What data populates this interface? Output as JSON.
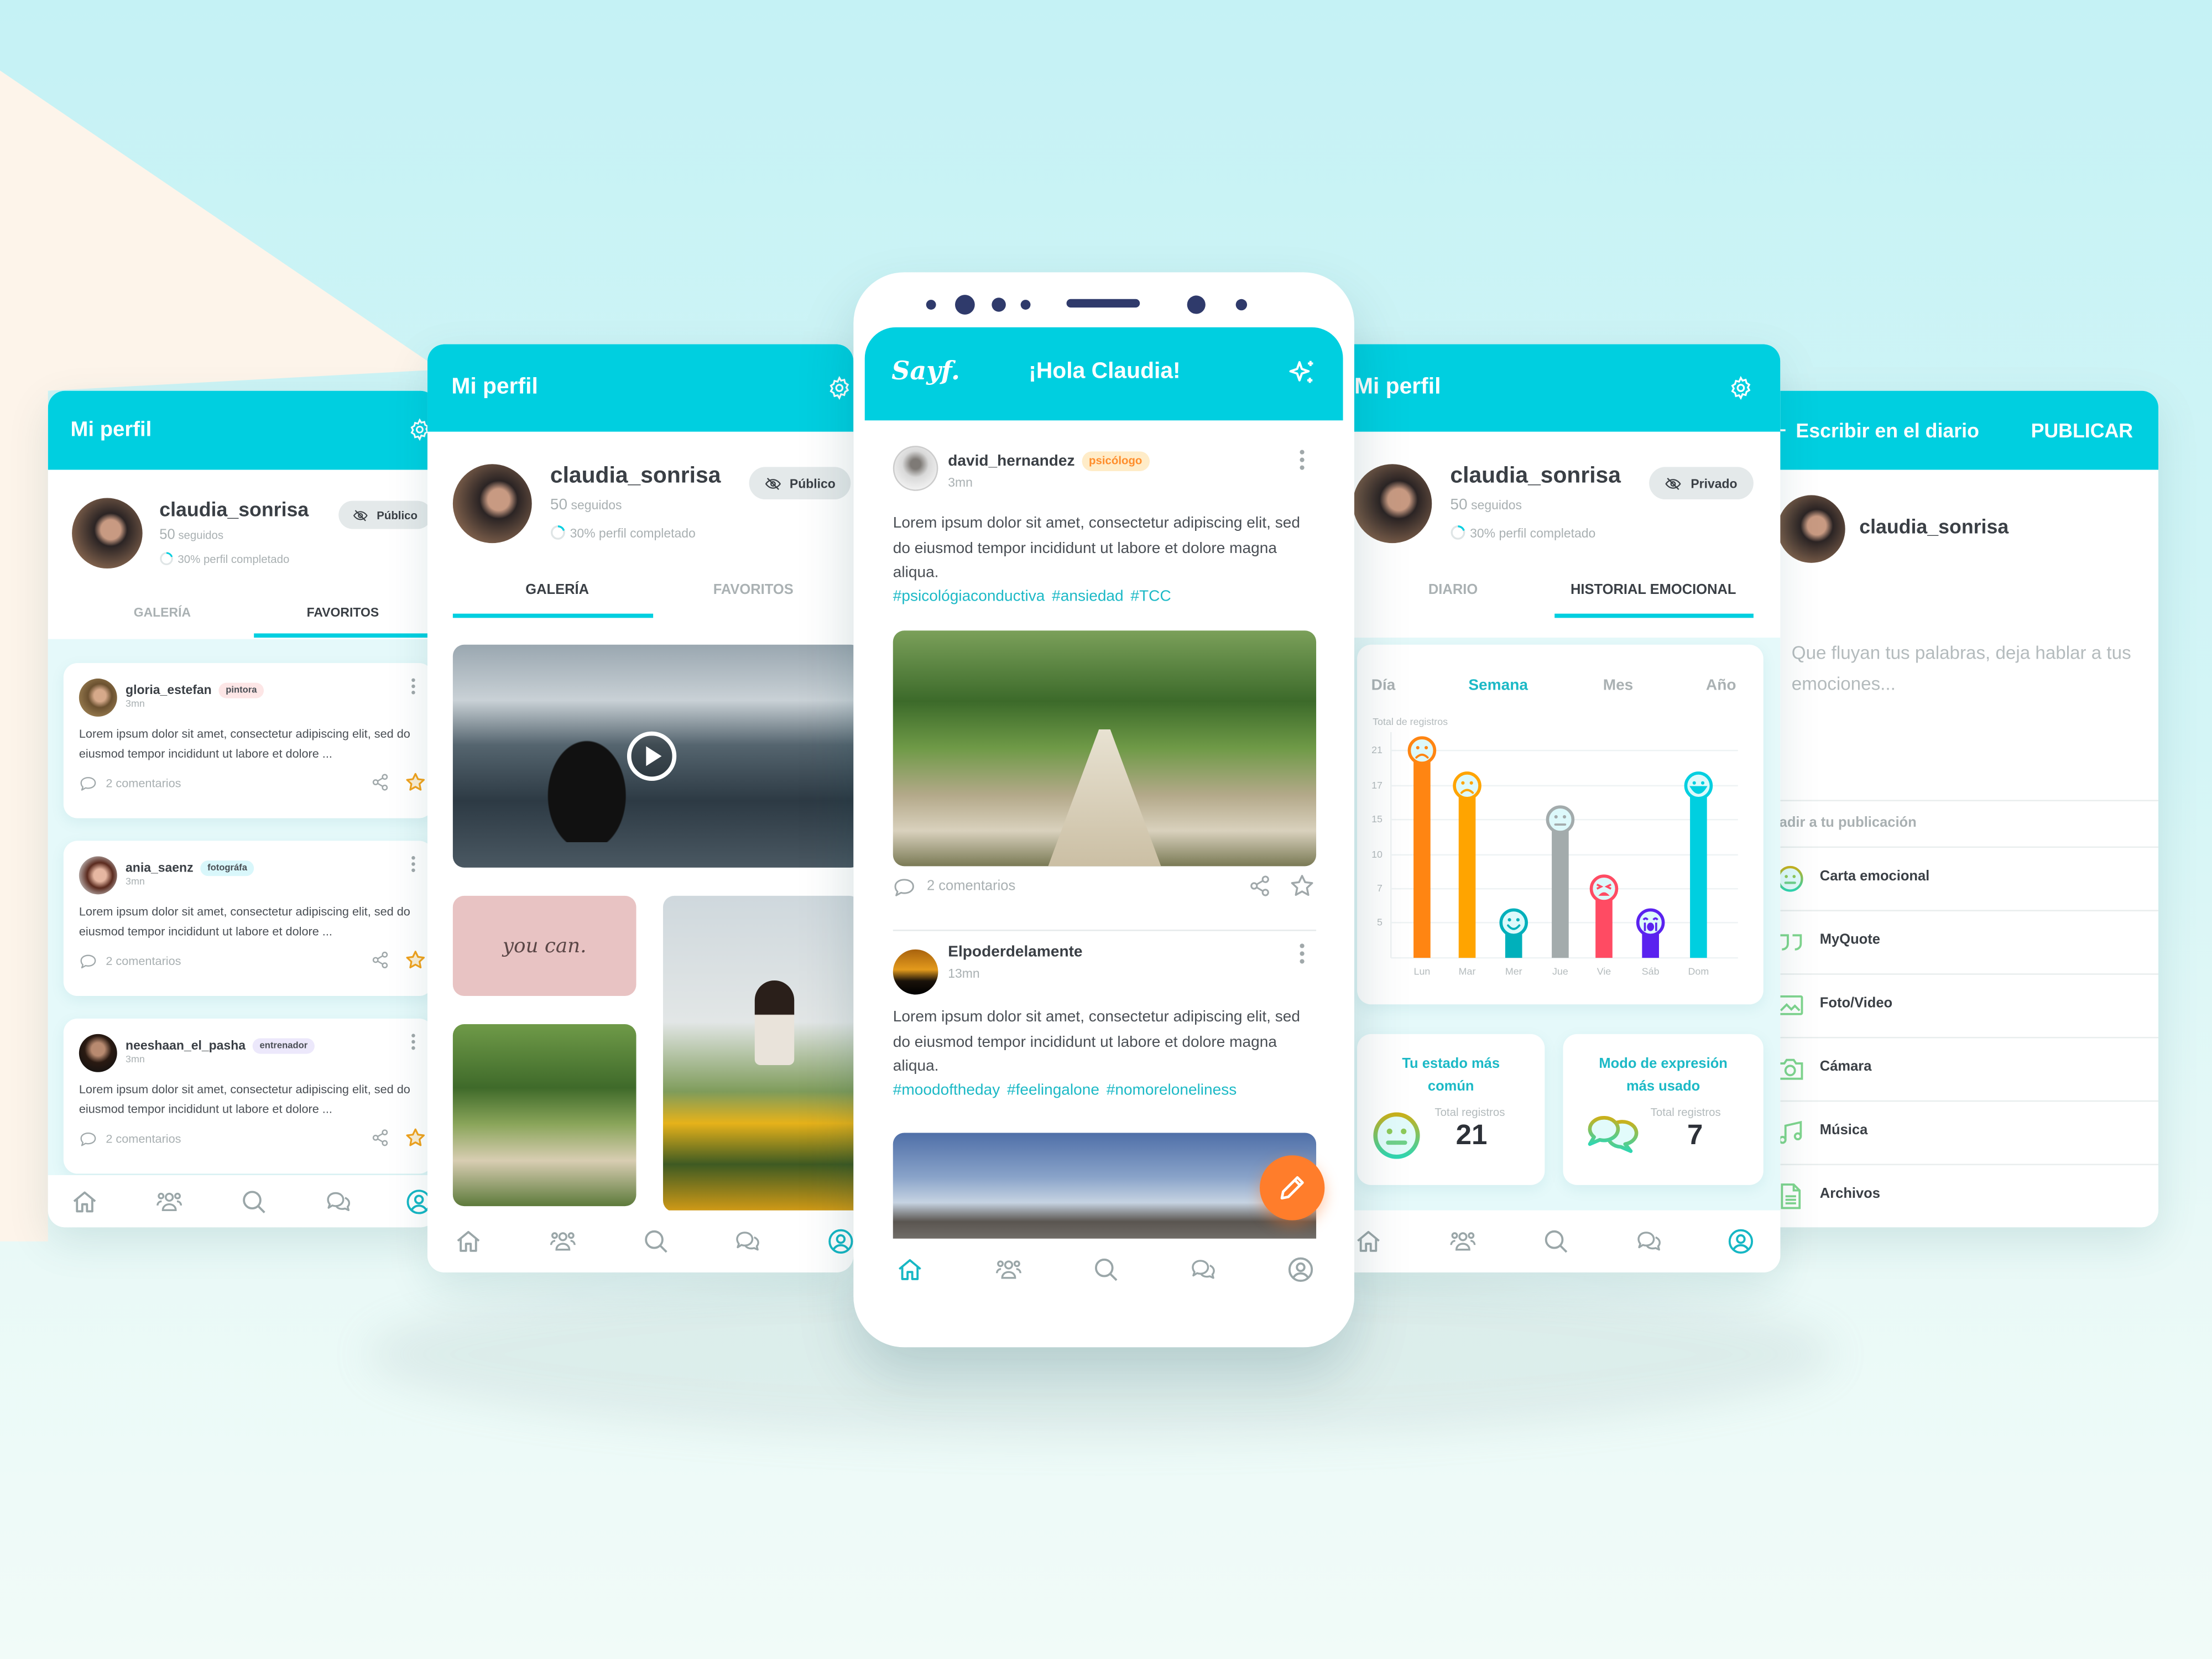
{
  "colors": {
    "brand": "#00cfe0",
    "accent_orange": "#ff7d2b",
    "text_dark": "#3a3f45",
    "text_muted": "#a9b0b2",
    "hashtag": "#1cb9c6",
    "star": "#f0a21d"
  },
  "panel_favorites": {
    "header_title": "Mi perfil",
    "profile": {
      "username": "claudia_sonrisa",
      "following_count": "50",
      "following_label": "seguidos",
      "completion_text": "30% perfil completado",
      "completion_pct": 30,
      "visibility": "Público"
    },
    "tabs": [
      {
        "label": "GALERÍA"
      },
      {
        "label": "FAVORITOS"
      }
    ],
    "active_tab": "FAVORITOS",
    "posts": [
      {
        "user": "gloria_estefan",
        "role": "pintora",
        "role_color": "#fde6e6",
        "time": "3mn",
        "text": "Lorem ipsum dolor sit amet, consectetur adipiscing elit, sed do eiusmod tempor incididunt ut labore et dolore ...",
        "comments": "2 comentarios"
      },
      {
        "user": "ania_saenz",
        "role": "fotográfa",
        "role_color": "#d9f7fb",
        "time": "3mn",
        "text": "Lorem ipsum dolor sit amet, consectetur adipiscing elit, sed do eiusmod tempor incididunt ut labore et dolore ...",
        "comments": "2 comentarios"
      },
      {
        "user": "neeshaan_el_pasha",
        "role": "entrenador",
        "role_color": "#ece8fb",
        "time": "3mn",
        "text": "Lorem ipsum dolor sit amet, consectetur adipiscing elit, sed do eiusmod tempor incididunt ut labore et dolore ...",
        "comments": "2 comentarios"
      }
    ],
    "active_nav": "profile"
  },
  "panel_gallery": {
    "header_title": "Mi perfil",
    "profile": {
      "username": "claudia_sonrisa",
      "following_count": "50",
      "following_label": "seguidos",
      "completion_text": "30% perfil completado",
      "completion_pct": 30,
      "visibility": "Público"
    },
    "tabs": [
      {
        "label": "GALERÍA"
      },
      {
        "label": "FAVORITOS"
      }
    ],
    "active_tab": "GALERÍA",
    "handwritten_card": "you can.",
    "active_nav": "profile"
  },
  "feed": {
    "logo": "Sayf.",
    "greeting": "¡Hola Claudia!",
    "posts": [
      {
        "user": "david_hernandez",
        "role": "psicólogo",
        "time": "3mn",
        "text": "Lorem ipsum dolor sit amet, consectetur adipiscing elit, sed do eiusmod tempor incididunt ut labore et dolore magna aliqua.",
        "hashtags": [
          "#psicológiaconductiva",
          "#ansiedad",
          "#TCC"
        ],
        "comments": "2 comentarios"
      },
      {
        "user": "Elpoderdelamente",
        "time": "13mn",
        "text": "Lorem ipsum dolor sit amet, consectetur adipiscing elit, sed do eiusmod tempor incididunt ut labore et dolore magna aliqua.",
        "hashtags": [
          "#moodoftheday",
          "#feelingalone",
          "#nomoreloneliness"
        ]
      }
    ],
    "active_nav": "home"
  },
  "panel_history": {
    "header_title": "Mi perfil",
    "profile": {
      "username": "claudia_sonrisa",
      "following_count": "50",
      "following_label": "seguidos",
      "completion_text": "30% perfil completado",
      "completion_pct": 30,
      "visibility": "Privado"
    },
    "tabs": [
      {
        "label": "DIARIO"
      },
      {
        "label": "HISTORIAL EMOCIONAL"
      }
    ],
    "active_tab": "HISTORIAL EMOCIONAL",
    "periods": [
      "Día",
      "Semana",
      "Mes",
      "Año"
    ],
    "active_period": "Semana",
    "stats": [
      {
        "title": "Tu estado más común",
        "label": "Total registros",
        "value": "21",
        "icon": "neutral-face"
      },
      {
        "title": "Modo de expresión más usado",
        "label": "Total registros",
        "value": "7",
        "icon": "chat-bubbles"
      }
    ],
    "active_nav": "profile"
  },
  "chart_data": {
    "type": "bar",
    "ylabel": "Total de registros",
    "categories": [
      "Lun",
      "Mar",
      "Mer",
      "Jue",
      "Vie",
      "Sáb",
      "Dom"
    ],
    "values": [
      21,
      17,
      5,
      15,
      7,
      5,
      17
    ],
    "moods": [
      "sad",
      "sad",
      "happy",
      "neutral",
      "angry",
      "crying",
      "very-happy"
    ],
    "bar_colors": [
      "#ff8512",
      "#ffa400",
      "#00b0bb",
      "#a3abac",
      "#ff4b63",
      "#5a22ef",
      "#00cfe0"
    ],
    "yticks": [
      5,
      7,
      10,
      15,
      17,
      21
    ],
    "grid": true
  },
  "panel_diary": {
    "title": "Escribir en el diario",
    "publish": "PUBLICAR",
    "username": "claudia_sonrisa",
    "placeholder": "Que fluyan tus palabras, deja hablar a tus emociones...",
    "section_label": "Añadir a tu publicación",
    "options": [
      {
        "label": "Carta emocional",
        "icon": "neutral-face"
      },
      {
        "label": "MyQuote",
        "icon": "quote"
      },
      {
        "label": "Foto/Video",
        "icon": "image"
      },
      {
        "label": "Cámara",
        "icon": "camera"
      },
      {
        "label": "Música",
        "icon": "music"
      },
      {
        "label": "Archivos",
        "icon": "file"
      }
    ]
  }
}
